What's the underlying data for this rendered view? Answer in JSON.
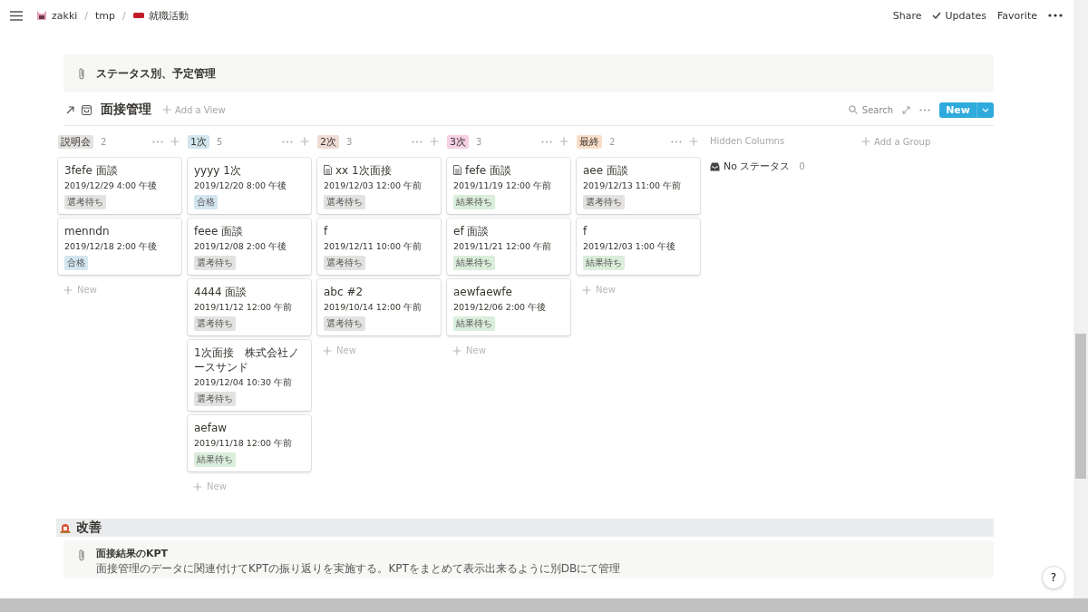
{
  "topbar": {
    "separator": "/",
    "breadcrumb": [
      {
        "label": "zakki",
        "kind": "workspace"
      },
      {
        "label": "tmp",
        "kind": "plain"
      },
      {
        "label": "就職活動",
        "kind": "flagged"
      }
    ],
    "actions": [
      {
        "label": "Share",
        "check": false
      },
      {
        "label": "Updates",
        "check": true
      },
      {
        "label": "Favorite",
        "check": false
      }
    ]
  },
  "callout": {
    "text": "ステータス別、予定管理"
  },
  "database": {
    "title": "面接管理",
    "add_view": "Add a View",
    "search": "Search",
    "new_button": "New",
    "columns": [
      {
        "label": "説明会",
        "color": "#e3e2e0",
        "count": "2",
        "new_label": "New",
        "cards": [
          {
            "title": "3fefe 面談",
            "page_icon": false,
            "date": "2019/12/29 4:00 午後",
            "tag": {
              "label": "選考待ち",
              "color": "#e3e2e0"
            }
          },
          {
            "title": "menndn",
            "page_icon": false,
            "date": "2019/12/18 2:00 午後",
            "tag": {
              "label": "合格",
              "color": "#d3e5ef"
            }
          }
        ]
      },
      {
        "label": "1次",
        "color": "#d3e5ef",
        "count": "5",
        "new_label": "New",
        "cards": [
          {
            "title": "yyyy 1次",
            "page_icon": false,
            "date": "2019/12/20 8:00 午後",
            "tag": {
              "label": "合格",
              "color": "#d3e5ef"
            }
          },
          {
            "title": "feee 面談",
            "page_icon": false,
            "date": "2019/12/08 2:00 午後",
            "tag": {
              "label": "選考待ち",
              "color": "#e3e2e0"
            }
          },
          {
            "title": "4444 面談",
            "page_icon": false,
            "date": "2019/11/12 12:00 午前",
            "tag": {
              "label": "選考待ち",
              "color": "#e3e2e0"
            }
          },
          {
            "title": "1次面接　株式会社ノースサンド",
            "page_icon": false,
            "date": "2019/12/04 10:30 午前",
            "tag": {
              "label": "選考待ち",
              "color": "#e3e2e0"
            }
          },
          {
            "title": "aefaw",
            "page_icon": false,
            "date": "2019/11/18 12:00 午前",
            "tag": {
              "label": "結果待ち",
              "color": "#dbeddb"
            }
          }
        ]
      },
      {
        "label": "2次",
        "color": "#eedcd5",
        "count": "3",
        "new_label": "New",
        "cards": [
          {
            "title": "xx 1次面接",
            "page_icon": true,
            "date": "2019/12/03 12:00 午前",
            "tag": {
              "label": "選考待ち",
              "color": "#e3e2e0"
            }
          },
          {
            "title": "f",
            "page_icon": false,
            "date": "2019/12/11 10:00 午前",
            "tag": {
              "label": "選考待ち",
              "color": "#e3e2e0"
            }
          },
          {
            "title": "abc #2",
            "page_icon": false,
            "date": "2019/10/14 12:00 午前",
            "tag": {
              "label": "選考待ち",
              "color": "#e3e2e0"
            }
          }
        ]
      },
      {
        "label": "3次",
        "color": "#f5cfe3",
        "count": "3",
        "new_label": "New",
        "cards": [
          {
            "title": "fefe 面談",
            "page_icon": true,
            "date": "2019/11/19 12:00 午前",
            "tag": {
              "label": "結果待ち",
              "color": "#dbeddb"
            }
          },
          {
            "title": "ef 面談",
            "page_icon": false,
            "date": "2019/11/21 12:00 午前",
            "tag": {
              "label": "結果待ち",
              "color": "#dbeddb"
            }
          },
          {
            "title": "aewfaewfe",
            "page_icon": false,
            "date": "2019/12/06 2:00 午後",
            "tag": {
              "label": "結果待ち",
              "color": "#dbeddb"
            }
          }
        ]
      },
      {
        "label": "最終",
        "color": "#fadec9",
        "count": "2",
        "new_label": "New",
        "cards": [
          {
            "title": "aee 面談",
            "page_icon": false,
            "date": "2019/12/13 11:00 午前",
            "tag": {
              "label": "選考待ち",
              "color": "#e3e2e0"
            }
          },
          {
            "title": "f",
            "page_icon": false,
            "date": "2019/12/03 1:00 午後",
            "tag": {
              "label": "結果待ち",
              "color": "#dbeddb"
            }
          }
        ]
      }
    ],
    "hidden_columns": {
      "title": "Hidden Columns",
      "items": [
        {
          "label": "No ステータス",
          "count": "0"
        }
      ]
    },
    "add_group": "Add a Group"
  },
  "section": {
    "heading": "改善"
  },
  "kpt_callout": {
    "title": "面接結果のKPT",
    "body": "面接管理のデータに関連付けてKPTの振り返りを実施する。KPTをまとめて表示出来るように別DBにて管理"
  },
  "help_button": "?"
}
